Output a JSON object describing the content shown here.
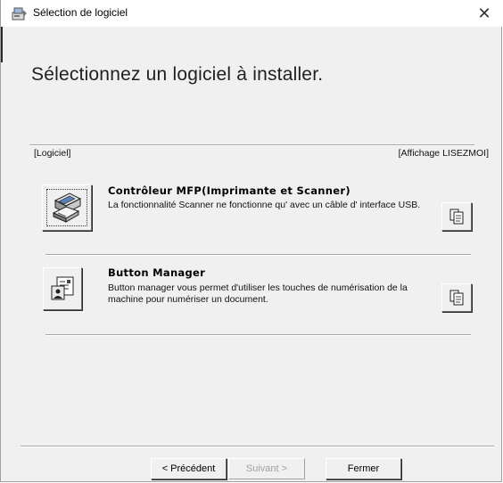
{
  "window": {
    "title": "Sélection de logiciel",
    "close_symbol": "✕"
  },
  "heading": "Sélectionnez un logiciel à installer.",
  "columns": {
    "left": "[Logiciel]",
    "right": "[Affichage LISEZMOI]"
  },
  "items": [
    {
      "icon": "scanner-printer-icon",
      "title": "Contrôleur MFP(Imprimante et Scanner)",
      "description": "La fonctionnalité Scanner ne fonctionne qu' avec un câble d' interface USB.",
      "readme_icon": "document-icon"
    },
    {
      "icon": "button-manager-icon",
      "title": "Button Manager",
      "description": "Button manager vous permet d'utiliser les touches de numérisation de la machine pour numériser un document.",
      "readme_icon": "document-icon"
    }
  ],
  "buttons": {
    "previous": "< Précédent",
    "next": "Suivant >",
    "close": "Fermer"
  }
}
